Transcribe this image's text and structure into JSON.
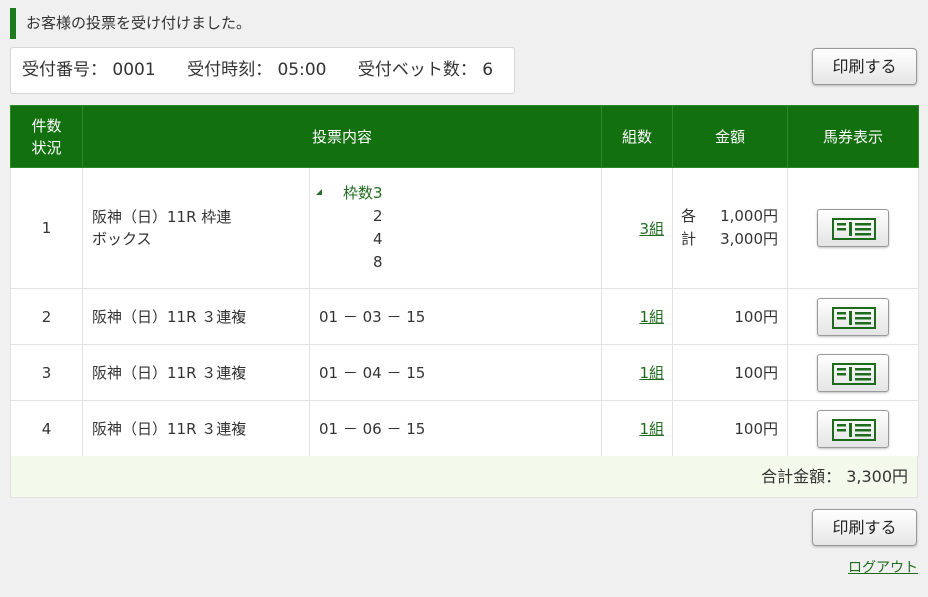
{
  "heading": "お客様の投票を受け付けました。",
  "receipt": {
    "number_label": "受付番号：",
    "number": "0001",
    "time_label": "受付時刻：",
    "time": "05:00",
    "bets_label": "受付ベット数：",
    "bets": "6"
  },
  "print_label": "印刷する",
  "table": {
    "headers": {
      "count_line1": "件数",
      "count_line2": "状況",
      "content": "投票内容",
      "kumi": "組数",
      "amount": "金額",
      "ticket": "馬券表示"
    },
    "rows": [
      {
        "no": "1",
        "race_line1": "阪神（日）11R 枠連",
        "race_line2": "ボックス",
        "box_label": "枠数3",
        "box_items": [
          "2",
          "4",
          "8"
        ],
        "kumi": "3組",
        "each_label": "各",
        "each_amount": "1,000円",
        "total_label": "計",
        "total_amount": "3,000円"
      },
      {
        "no": "2",
        "race": "阪神（日）11R ３連複",
        "selection": "01 － 03 － 15",
        "kumi": "1組",
        "amount": "100円"
      },
      {
        "no": "3",
        "race": "阪神（日）11R ３連複",
        "selection": "01 － 04 － 15",
        "kumi": "1組",
        "amount": "100円"
      },
      {
        "no": "4",
        "race": "阪神（日）11R ３連複",
        "selection": "01 － 06 － 15",
        "kumi": "1組",
        "amount": "100円"
      }
    ],
    "total_label": "合計金額：",
    "total_value": "3,300円"
  },
  "ticket_icon": "ticket-icon",
  "logout": "ログアウト",
  "colors": {
    "header_green": "#12700f",
    "link_green": "#1f6b1f",
    "total_bg": "#f3faeb"
  }
}
